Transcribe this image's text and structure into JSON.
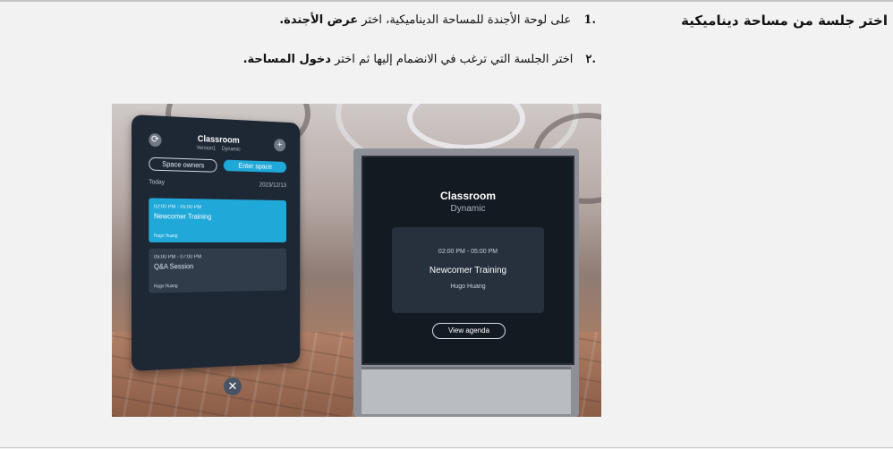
{
  "heading": "اختر جلسة من مساحة ديناميكية",
  "steps": [
    {
      "number": ".1",
      "text": "على لوحة الأجندة للمساحة الديناميكية، اختر",
      "bold": "عرض الأجندة."
    },
    {
      "number": ".٢",
      "text": "اختر الجلسة التي ترغب في الانضمام إليها ثم اختر",
      "bold": "دخول المساحة."
    }
  ],
  "panel": {
    "title": "Classroom",
    "subtitle_version": "Version1",
    "subtitle_type": "Dynamic",
    "refresh_glyph": "⟳",
    "add_glyph": "+",
    "owners_label": "Space owners",
    "enter_label": "Enter space",
    "today_label": "Today",
    "date": "2023/12/13",
    "sessions": [
      {
        "time": "02:00 PM - 05:00 PM",
        "title": "Newcomer Training",
        "host": "Hugo Huang"
      },
      {
        "time": "05:00 PM - 07:00 PM",
        "title": "Q&A Session",
        "host": "Hugo Huang"
      }
    ],
    "close_glyph": "✕"
  },
  "kiosk": {
    "title": "Classroom",
    "subtitle": "Dynamic",
    "time": "02:00 PM - 05:00 PM",
    "session": "Newcomer Training",
    "host": "Hugo Huang",
    "button": "View agenda"
  },
  "colors": {
    "accent": "#1fa8d8",
    "panel": "#1e2734",
    "card": "#313c4b"
  }
}
